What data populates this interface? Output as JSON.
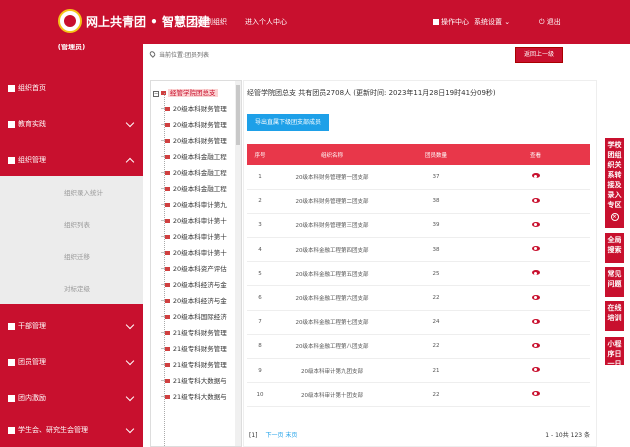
{
  "header": {
    "brand": "网上共青团 • 智慧团建",
    "switch_org": "切换到组织",
    "personal_center": "进入个人中心",
    "operation_center": "操作中心",
    "system_settings": "系统设置",
    "logout": "退出"
  },
  "sidebar": {
    "role": "(管理员)",
    "items": [
      {
        "label": "组织首页"
      },
      {
        "label": "教育实践"
      },
      {
        "label": "组织管理"
      },
      {
        "label": "干部管理"
      },
      {
        "label": "团员管理"
      },
      {
        "label": "团内激励"
      },
      {
        "label": "学生会、研究生会管理"
      }
    ],
    "subitems": [
      "组织录入统计",
      "组织列表",
      "组织迁移",
      "对标定级"
    ]
  },
  "breadcrumb": "当前位置:团员列表",
  "back_button": "返回上一级",
  "tree": {
    "root": "经管学院团总支",
    "nodes": [
      "20级本科财务管理",
      "20级本科财务管理",
      "20级本科财务管理",
      "20级本科金融工程",
      "20级本科金融工程",
      "20级本科金融工程",
      "20级本科审计第九",
      "20级本科审计第十",
      "20级本科审计第十",
      "20级本科审计第十",
      "20级本科资产评估",
      "20级本科经济与金",
      "20级本科经济与金",
      "20级本科国际经济",
      "21级专科财务管理",
      "21级专科财务管理",
      "21级专科财务管理",
      "21级专科大数据与",
      "21级专科大数据与"
    ]
  },
  "panel": {
    "title": "经管学院团总支 共有团员2708人 (更新时间: 2023年11月28日19时41分09秒)",
    "export_button": "导出直属下级团支部成员",
    "columns": [
      "序号",
      "组织名称",
      "团员数量",
      "查看"
    ],
    "rows": [
      {
        "idx": "1",
        "name": "20级本科财务管理第一团支部",
        "count": "37"
      },
      {
        "idx": "2",
        "name": "20级本科财务管理第二团支部",
        "count": "38"
      },
      {
        "idx": "3",
        "name": "20级本科财务管理第三团支部",
        "count": "39"
      },
      {
        "idx": "4",
        "name": "20级本科金融工程第四团支部",
        "count": "38"
      },
      {
        "idx": "5",
        "name": "20级本科金融工程第五团支部",
        "count": "25"
      },
      {
        "idx": "6",
        "name": "20级本科金融工程第六团支部",
        "count": "22"
      },
      {
        "idx": "7",
        "name": "20级本科金融工程第七团支部",
        "count": "24"
      },
      {
        "idx": "8",
        "name": "20级本科金融工程第八团支部",
        "count": "22"
      },
      {
        "idx": "9",
        "name": "20级本科审计第九团支部",
        "count": "21"
      },
      {
        "idx": "10",
        "name": "20级本科审计第十团支部",
        "count": "22"
      }
    ],
    "pager_current": "[1]",
    "pager_next": "下一页 末页",
    "pager_info": "1 - 10共 123 条"
  },
  "right_tabs": [
    {
      "label": "学校团组织关系转接及录入专区"
    },
    {
      "label": "全局搜索"
    },
    {
      "label": "常见问题"
    },
    {
      "label": "在线培训"
    },
    {
      "label": "小程序日一日"
    }
  ],
  "colors": {
    "brand_red": "#c8102e",
    "accent_blue": "#1ea0e8"
  }
}
